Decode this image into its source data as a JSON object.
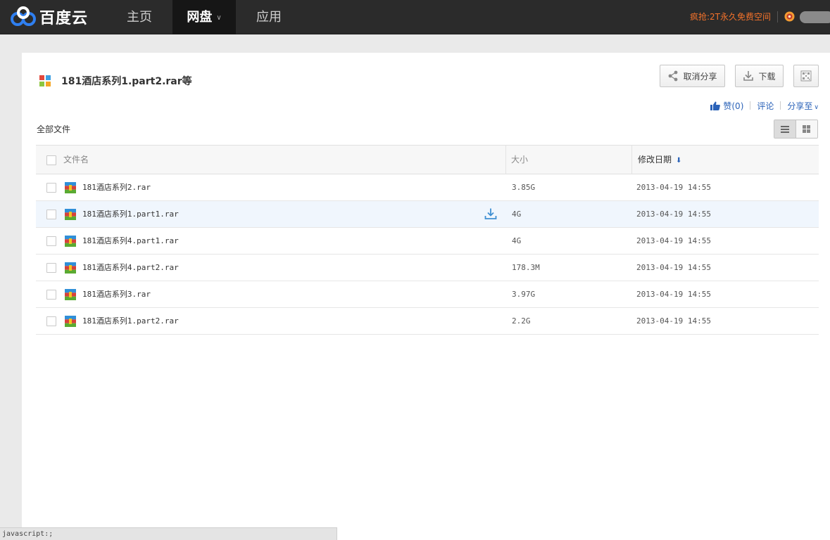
{
  "nav": {
    "brand": "百度云",
    "items": [
      {
        "label": "主页"
      },
      {
        "label": "网盘"
      },
      {
        "label": "应用"
      }
    ],
    "promo": "疯抢:2T永久免费空间"
  },
  "share": {
    "title": "181酒店系列1.part2.rar等",
    "buttons": {
      "cancel_share": "取消分享",
      "download": "下载"
    },
    "social": {
      "like": "赞(0)",
      "comment": "评论",
      "share_to": "分享至"
    },
    "breadcrumb": "全部文件"
  },
  "table": {
    "columns": {
      "name": "文件名",
      "size": "大小",
      "modified": "修改日期"
    },
    "rows": [
      {
        "name": "181酒店系列2.rar",
        "size": "3.85G",
        "date": "2013-04-19 14:55"
      },
      {
        "name": "181酒店系列1.part1.rar",
        "size": "4G",
        "date": "2013-04-19 14:55"
      },
      {
        "name": "181酒店系列4.part1.rar",
        "size": "4G",
        "date": "2013-04-19 14:55"
      },
      {
        "name": "181酒店系列4.part2.rar",
        "size": "178.3M",
        "date": "2013-04-19 14:55"
      },
      {
        "name": "181酒店系列3.rar",
        "size": "3.97G",
        "date": "2013-04-19 14:55"
      },
      {
        "name": "181酒店系列1.part2.rar",
        "size": "2.2G",
        "date": "2013-04-19 14:55"
      }
    ]
  },
  "statusbar": "javascript:;",
  "colors": {
    "topbar": "#2b2b2b",
    "accent_link": "#2a62b8",
    "promo": "#f4722b"
  }
}
